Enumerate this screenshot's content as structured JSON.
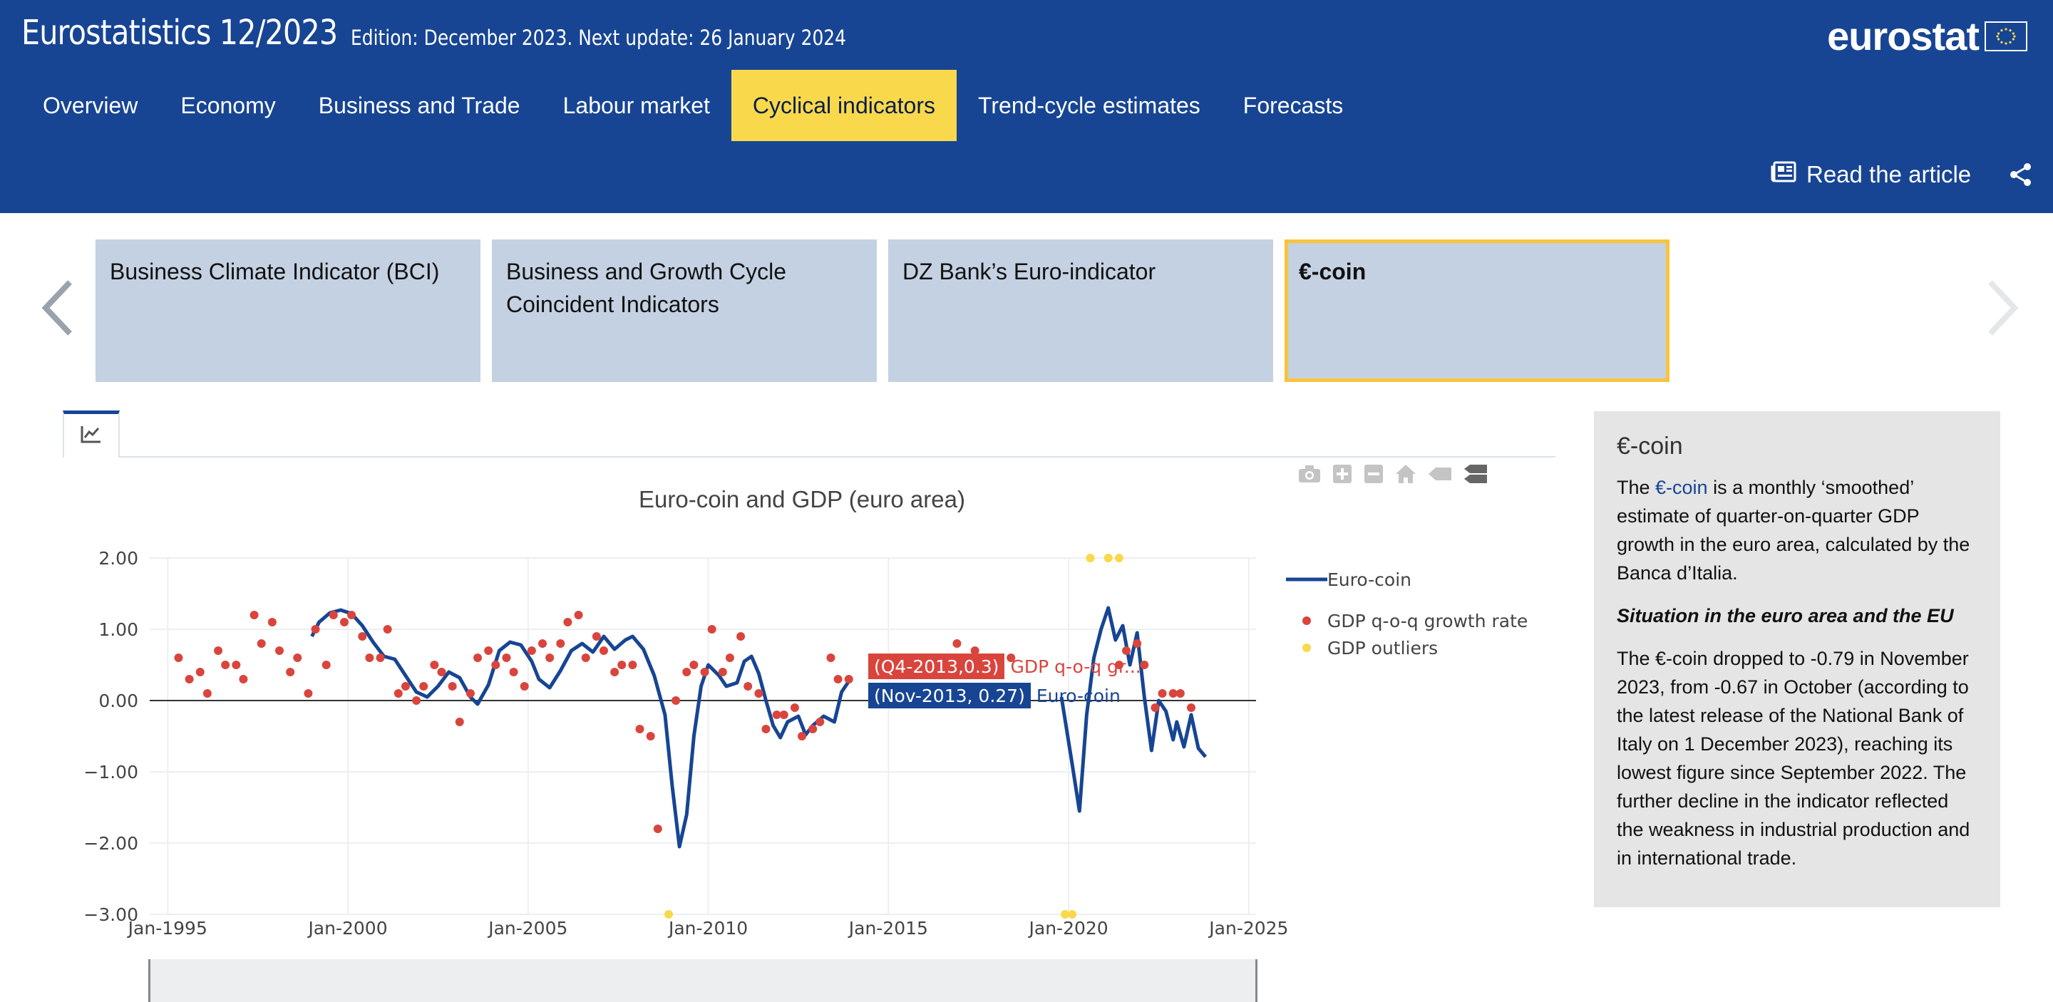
{
  "header": {
    "title": "Eurostatistics 12/2023",
    "edition": "Edition: December 2023. Next update: 26 January 2024",
    "logo_text": "eurostat",
    "read_article": "Read the article"
  },
  "nav": [
    {
      "label": "Overview",
      "active": false
    },
    {
      "label": "Economy",
      "active": false
    },
    {
      "label": "Business and Trade",
      "active": false
    },
    {
      "label": "Labour market",
      "active": false
    },
    {
      "label": "Cyclical indicators",
      "active": true
    },
    {
      "label": "Trend-cycle estimates",
      "active": false
    },
    {
      "label": "Forecasts",
      "active": false
    }
  ],
  "cards": [
    {
      "label": "Business Climate Indicator (BCI)",
      "active": false
    },
    {
      "label": "Business and Growth Cycle Coincident Indicators",
      "active": false
    },
    {
      "label": "DZ Bank’s Euro-indicator",
      "active": false
    },
    {
      "label": "€-coin",
      "active": true
    }
  ],
  "colors": {
    "brand": "#174594",
    "accent": "#f9d94b",
    "gdp": "#d9453d",
    "outliers": "#f9d94b",
    "card": "#c4d1e2"
  },
  "tooltips": {
    "gdp": {
      "box": "(Q4-2013,0.3)",
      "label": "GDP q-o-q gr..."
    },
    "coin": {
      "box": "(Nov-2013, 0.27)",
      "label": "Euro-coin"
    }
  },
  "chart_data": {
    "type": "line",
    "title": "Euro-coin and GDP (euro area)",
    "xlabel": "",
    "ylabel": "",
    "ylim": [
      -3,
      2
    ],
    "xlim": [
      1994.5,
      2025.2
    ],
    "yticks": [
      2,
      1,
      0,
      -1,
      -2,
      -3
    ],
    "ytick_labels": [
      "2.00",
      "1.00",
      "0.00",
      "−1.00",
      "−2.00",
      "−3.00"
    ],
    "xticks": [
      1995,
      2000,
      2005,
      2010,
      2015,
      2020,
      2025
    ],
    "xtick_labels": [
      "Jan-1995",
      "Jan-2000",
      "Jan-2005",
      "Jan-2010",
      "Jan-2015",
      "Jan-2020",
      "Jan-2025"
    ],
    "legend_position": "right",
    "grid": true,
    "series": [
      {
        "name": "Euro-coin",
        "kind": "line",
        "color": "#174594",
        "points": [
          [
            1999.0,
            0.9
          ],
          [
            1999.2,
            1.1
          ],
          [
            1999.5,
            1.23
          ],
          [
            1999.8,
            1.27
          ],
          [
            2000.1,
            1.22
          ],
          [
            2000.4,
            1.05
          ],
          [
            2000.7,
            0.82
          ],
          [
            2001.0,
            0.62
          ],
          [
            2001.3,
            0.58
          ],
          [
            2001.6,
            0.35
          ],
          [
            2001.9,
            0.12
          ],
          [
            2002.2,
            0.05
          ],
          [
            2002.5,
            0.2
          ],
          [
            2002.8,
            0.4
          ],
          [
            2003.1,
            0.32
          ],
          [
            2003.4,
            0.05
          ],
          [
            2003.6,
            -0.05
          ],
          [
            2003.9,
            0.22
          ],
          [
            2004.2,
            0.7
          ],
          [
            2004.5,
            0.82
          ],
          [
            2004.8,
            0.78
          ],
          [
            2005.1,
            0.55
          ],
          [
            2005.3,
            0.3
          ],
          [
            2005.6,
            0.18
          ],
          [
            2005.9,
            0.42
          ],
          [
            2006.2,
            0.7
          ],
          [
            2006.5,
            0.8
          ],
          [
            2006.8,
            0.68
          ],
          [
            2007.1,
            0.9
          ],
          [
            2007.4,
            0.72
          ],
          [
            2007.7,
            0.85
          ],
          [
            2007.9,
            0.9
          ],
          [
            2008.2,
            0.72
          ],
          [
            2008.5,
            0.35
          ],
          [
            2008.8,
            -0.2
          ],
          [
            2009.0,
            -1.2
          ],
          [
            2009.2,
            -2.05
          ],
          [
            2009.4,
            -1.6
          ],
          [
            2009.6,
            -0.5
          ],
          [
            2009.8,
            0.2
          ],
          [
            2010.0,
            0.5
          ],
          [
            2010.3,
            0.35
          ],
          [
            2010.5,
            0.2
          ],
          [
            2010.8,
            0.25
          ],
          [
            2011.0,
            0.55
          ],
          [
            2011.2,
            0.62
          ],
          [
            2011.4,
            0.38
          ],
          [
            2011.6,
            0.0
          ],
          [
            2011.8,
            -0.35
          ],
          [
            2012.0,
            -0.52
          ],
          [
            2012.2,
            -0.3
          ],
          [
            2012.5,
            -0.22
          ],
          [
            2012.7,
            -0.48
          ],
          [
            2012.9,
            -0.35
          ],
          [
            2013.2,
            -0.22
          ],
          [
            2013.5,
            -0.3
          ],
          [
            2013.7,
            0.12
          ],
          [
            2013.9,
            0.27
          ]
        ],
        "points_late": [
          [
            2019.8,
            0.05
          ],
          [
            2020.1,
            -0.9
          ],
          [
            2020.3,
            -1.55
          ],
          [
            2020.5,
            -0.2
          ],
          [
            2020.7,
            0.6
          ],
          [
            2020.9,
            1.0
          ],
          [
            2021.1,
            1.3
          ],
          [
            2021.3,
            0.85
          ],
          [
            2021.5,
            1.05
          ],
          [
            2021.7,
            0.5
          ],
          [
            2021.9,
            0.95
          ],
          [
            2022.1,
            0.05
          ],
          [
            2022.3,
            -0.7
          ],
          [
            2022.5,
            0.0
          ],
          [
            2022.7,
            -0.15
          ],
          [
            2022.9,
            -0.55
          ],
          [
            2023.0,
            -0.3
          ],
          [
            2023.2,
            -0.65
          ],
          [
            2023.4,
            -0.2
          ],
          [
            2023.6,
            -0.67
          ],
          [
            2023.8,
            -0.79
          ]
        ]
      },
      {
        "name": "GDP q-o-q growth rate",
        "kind": "scatter",
        "color": "#d9453d",
        "points": [
          [
            1995.3,
            0.6
          ],
          [
            1995.6,
            0.3
          ],
          [
            1995.9,
            0.4
          ],
          [
            1996.1,
            0.1
          ],
          [
            1996.4,
            0.7
          ],
          [
            1996.6,
            0.5
          ],
          [
            1996.9,
            0.5
          ],
          [
            1997.1,
            0.3
          ],
          [
            1997.4,
            1.2
          ],
          [
            1997.6,
            0.8
          ],
          [
            1997.9,
            1.1
          ],
          [
            1998.1,
            0.7
          ],
          [
            1998.4,
            0.4
          ],
          [
            1998.6,
            0.6
          ],
          [
            1998.9,
            0.1
          ],
          [
            1999.1,
            1.0
          ],
          [
            1999.4,
            0.5
          ],
          [
            1999.6,
            1.2
          ],
          [
            1999.9,
            1.1
          ],
          [
            2000.1,
            1.2
          ],
          [
            2000.4,
            0.9
          ],
          [
            2000.6,
            0.6
          ],
          [
            2000.9,
            0.6
          ],
          [
            2001.1,
            1.0
          ],
          [
            2001.4,
            0.1
          ],
          [
            2001.6,
            0.2
          ],
          [
            2001.9,
            0.0
          ],
          [
            2002.1,
            0.2
          ],
          [
            2002.4,
            0.5
          ],
          [
            2002.6,
            0.4
          ],
          [
            2002.9,
            0.2
          ],
          [
            2003.1,
            -0.3
          ],
          [
            2003.4,
            0.1
          ],
          [
            2003.6,
            0.6
          ],
          [
            2003.9,
            0.7
          ],
          [
            2004.1,
            0.5
          ],
          [
            2004.4,
            0.6
          ],
          [
            2004.6,
            0.4
          ],
          [
            2004.9,
            0.2
          ],
          [
            2005.1,
            0.7
          ],
          [
            2005.4,
            0.8
          ],
          [
            2005.6,
            0.6
          ],
          [
            2005.9,
            0.8
          ],
          [
            2006.1,
            1.1
          ],
          [
            2006.4,
            1.2
          ],
          [
            2006.6,
            0.6
          ],
          [
            2006.9,
            0.9
          ],
          [
            2007.1,
            0.7
          ],
          [
            2007.4,
            0.4
          ],
          [
            2007.6,
            0.5
          ],
          [
            2007.9,
            0.5
          ],
          [
            2008.1,
            -0.4
          ],
          [
            2008.4,
            -0.5
          ],
          [
            2008.6,
            -1.8
          ],
          [
            2009.1,
            0.0
          ],
          [
            2009.4,
            0.4
          ],
          [
            2009.6,
            0.5
          ],
          [
            2009.9,
            0.4
          ],
          [
            2010.1,
            1.0
          ],
          [
            2010.4,
            0.4
          ],
          [
            2010.6,
            0.6
          ],
          [
            2010.9,
            0.9
          ],
          [
            2011.1,
            0.2
          ],
          [
            2011.4,
            0.1
          ],
          [
            2011.6,
            -0.4
          ],
          [
            2011.9,
            -0.2
          ],
          [
            2012.1,
            -0.2
          ],
          [
            2012.4,
            -0.1
          ],
          [
            2012.6,
            -0.5
          ],
          [
            2012.9,
            -0.4
          ],
          [
            2013.1,
            -0.3
          ],
          [
            2013.4,
            0.6
          ],
          [
            2013.6,
            0.3
          ],
          [
            2013.9,
            0.3
          ],
          [
            2016.9,
            0.8
          ],
          [
            2017.4,
            0.7
          ],
          [
            2018.4,
            0.6
          ],
          [
            2021.4,
            0.5
          ],
          [
            2021.6,
            0.7
          ],
          [
            2021.9,
            0.8
          ],
          [
            2022.1,
            0.5
          ],
          [
            2022.4,
            -0.1
          ],
          [
            2022.6,
            0.1
          ],
          [
            2022.9,
            0.1
          ],
          [
            2023.1,
            0.1
          ],
          [
            2023.4,
            -0.1
          ]
        ]
      },
      {
        "name": "GDP outliers",
        "kind": "scatter",
        "color": "#f9d94b",
        "points": [
          [
            2008.9,
            -3.0
          ],
          [
            2019.9,
            -3.0
          ],
          [
            2020.1,
            -3.0
          ],
          [
            2020.6,
            2.0
          ],
          [
            2021.1,
            2.0
          ],
          [
            2021.4,
            2.0
          ]
        ]
      }
    ]
  }
}
